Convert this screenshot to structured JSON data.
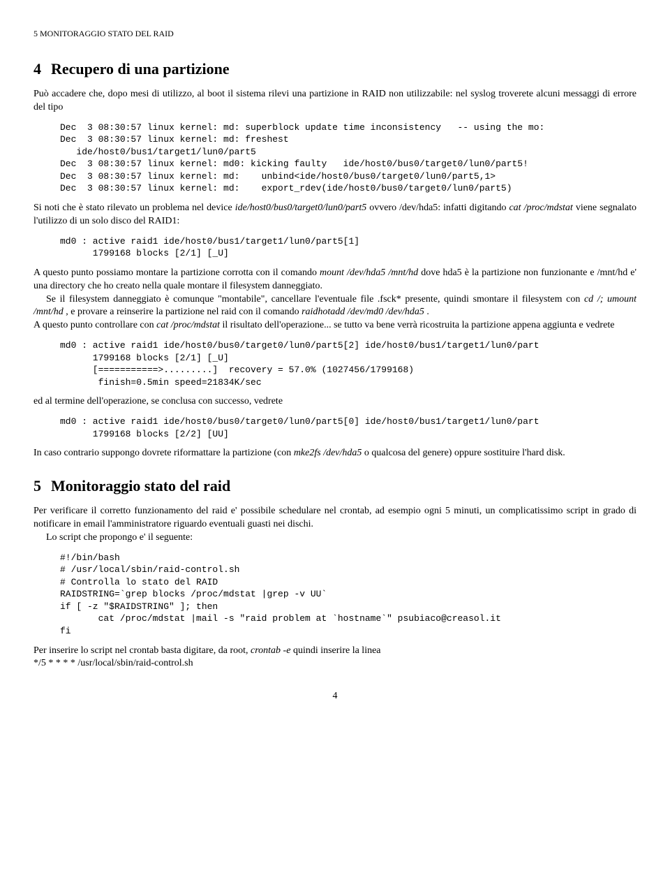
{
  "header": {
    "running_title": "5   MONITORAGGIO STATO DEL RAID"
  },
  "section4": {
    "number": "4",
    "title": "Recupero di una partizione",
    "intro_a": "Può accadere che, dopo mesi di utilizzo, al boot il sistema rilevi una partizione in RAID non utilizzabile: nel syslog troverete alcuni messaggi di errore del tipo",
    "code1": "Dec  3 08:30:57 linux kernel: md: superblock update time inconsistency   -- using the mo:\nDec  3 08:30:57 linux kernel: md: freshest\n   ide/host0/bus1/target1/lun0/part5\nDec  3 08:30:57 linux kernel: md0: kicking faulty   ide/host0/bus0/target0/lun0/part5!\nDec  3 08:30:57 linux kernel: md:    unbind<ide/host0/bus0/target0/lun0/part5,1>\nDec  3 08:30:57 linux kernel: md:    export_rdev(ide/host0/bus0/target0/lun0/part5)",
    "para2_a": "Si noti che è stato rilevato un problema nel device ",
    "para2_i1": "ide/host0/bus0/target0/lun0/part5",
    "para2_b": " ovvero /dev/hda5: infatti digitando ",
    "para2_i2": "cat /proc/mdstat",
    "para2_c": " viene segnalato l'utilizzo di un solo disco del RAID1:",
    "code2": "md0 : active raid1 ide/host0/bus1/target1/lun0/part5[1]\n      1799168 blocks [2/1] [_U]",
    "para3_a": "A questo punto possiamo montare la partizione corrotta con il comando ",
    "para3_i1": "mount /dev/hda5 /mnt/hd",
    "para3_b": " dove hda5 è la partizione non funzionante e /mnt/hd e' una directory che ho creato nella quale montare il filesystem danneggiato.",
    "para4_a": "Se il filesystem danneggiato è comunque \"montabile\", cancellare l'eventuale file .fsck* presente, quindi smontare il filesystem con ",
    "para4_i1": "cd /; umount /mnt/hd",
    "para4_b": " , e provare a reinserire la partizione nel raid con il comando ",
    "para4_i2": "raidhotadd /dev/md0 /dev/hda5",
    "para4_c": " .",
    "para5_a": "A questo punto controllare con ",
    "para5_i1": "cat /proc/mdstat",
    "para5_b": " il risultato dell'operazione... se tutto va bene verrà ricostruita la partizione appena aggiunta e vedrete",
    "code3": "md0 : active raid1 ide/host0/bus0/target0/lun0/part5[2] ide/host0/bus1/target1/lun0/part\n      1799168 blocks [2/1] [_U]\n      [===========>.........]  recovery = 57.0% (1027456/1799168)\n       finish=0.5min speed=21834K/sec",
    "para6": "ed al termine dell'operazione, se conclusa con successo, vedrete",
    "code4": "md0 : active raid1 ide/host0/bus0/target0/lun0/part5[0] ide/host0/bus1/target1/lun0/part\n      1799168 blocks [2/2] [UU]",
    "para7_a": "In caso contrario suppongo dovrete riformattare la partizione (con ",
    "para7_i1": "mke2fs /dev/hda5",
    "para7_b": " o qualcosa del genere) oppure sostituire l'hard disk."
  },
  "section5": {
    "number": "5",
    "title": "Monitoraggio stato del raid",
    "para1": "Per verificare il corretto funzionamento del raid e' possibile schedulare nel crontab, ad esempio ogni 5 minuti, un complicatissimo script in grado di notificare in email l'amministratore riguardo eventuali guasti nei dischi.",
    "para2": "Lo script che propongo e' il seguente:",
    "code1": "#!/bin/bash\n# /usr/local/sbin/raid-control.sh\n# Controlla lo stato del RAID\nRAIDSTRING=`grep blocks /proc/mdstat |grep -v UU`\nif [ -z \"$RAIDSTRING\" ]; then\n       cat /proc/mdstat |mail -s \"raid problem at `hostname`\" psubiaco@creasol.it\nfi",
    "para3_a": "Per inserire lo script nel crontab basta digitare, da root, ",
    "para3_i1": "crontab -e",
    "para3_b": " quindi inserire la linea",
    "para4": "*/5 * * * * /usr/local/sbin/raid-control.sh"
  },
  "footer": {
    "page_number": "4"
  }
}
